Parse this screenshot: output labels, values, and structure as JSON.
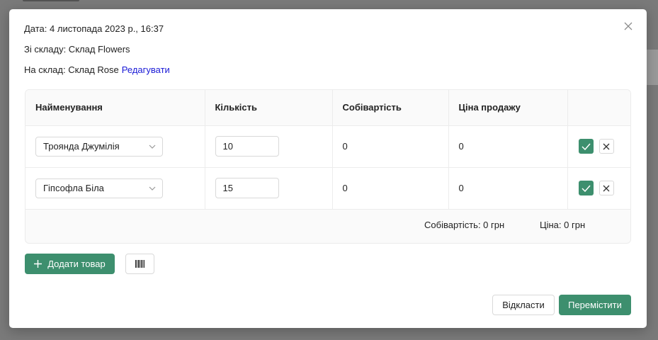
{
  "header": {
    "date_text": "Дата: 4 листопада 2023 р., 16:37",
    "from_text": "Зі складу: Склад Flowers",
    "to_text": "На склад: Склад Rose",
    "edit_link": "Редагувати"
  },
  "table": {
    "columns": [
      "Найменування",
      "Кількість",
      "Собівартість",
      "Ціна продажу",
      ""
    ],
    "rows": [
      {
        "name": "Троянда Джумілія",
        "quantity": "10",
        "cost": "0",
        "price": "0"
      },
      {
        "name": "Гіпсофла Біла",
        "quantity": "15",
        "cost": "0",
        "price": "0"
      }
    ],
    "total_cost": "Собівартість: 0 грн",
    "total_price": "Ціна: 0 грн"
  },
  "actions": {
    "add_item": "Додати товар",
    "defer": "Відкласти",
    "move": "Перемістити"
  },
  "icons": {
    "close": "close-icon",
    "add": "plus-icon",
    "barcode": "barcode-icon",
    "confirm": "check-icon",
    "remove": "x-icon",
    "dropdown": "chevron-down-icon"
  },
  "colors": {
    "primary": "#3d8f6e",
    "link": "#1a1ad6"
  }
}
